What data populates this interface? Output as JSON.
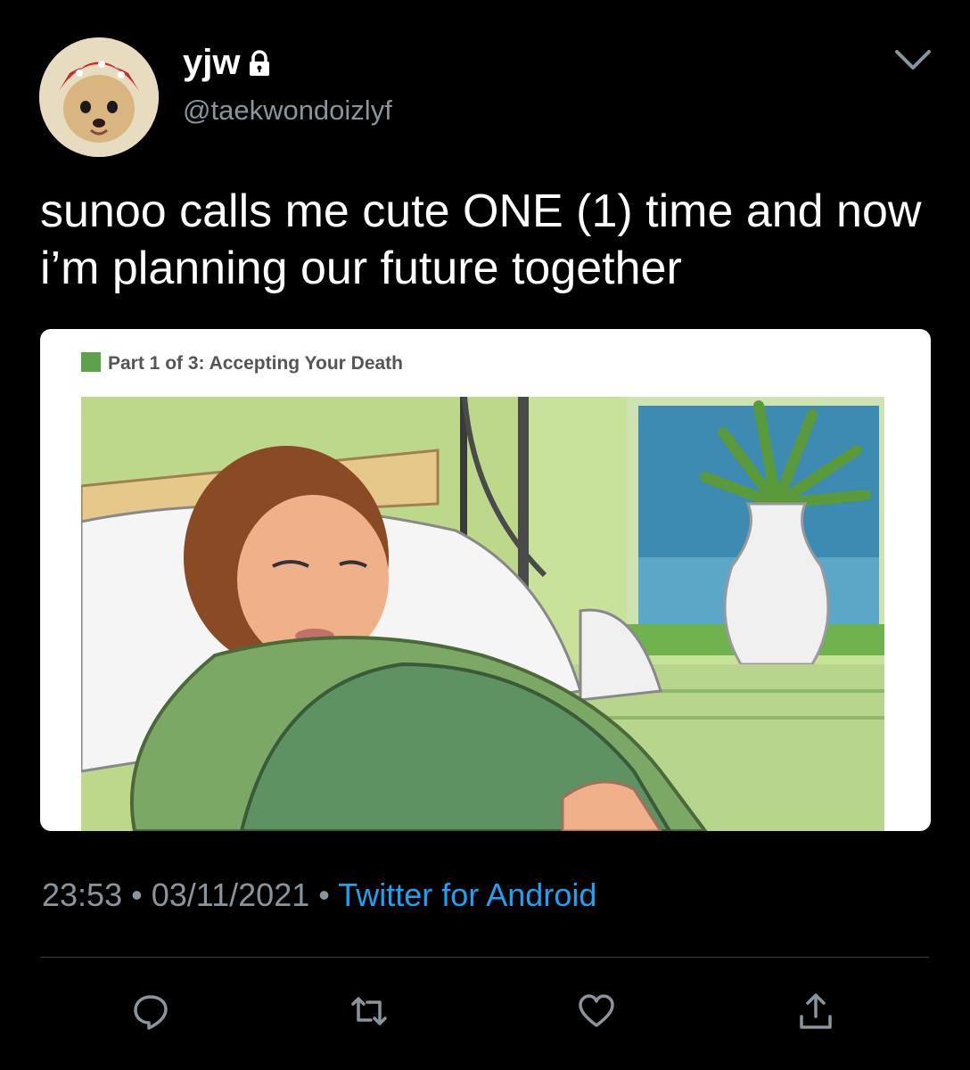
{
  "author": {
    "name": "yjw",
    "handle": "@taekwondoizlyf",
    "protected": true
  },
  "tweet": {
    "text": "sunoo calls me cute ONE (1) time and now i’m planning our future together"
  },
  "media": {
    "caption": "Part 1 of 3: Accepting Your Death"
  },
  "meta": {
    "time": "23:53",
    "separator": "•",
    "date": "03/11/2021",
    "source": "Twitter for Android"
  },
  "actions": [
    "reply-icon",
    "retweet-icon",
    "like-icon",
    "share-icon"
  ],
  "colors": {
    "background": "#000000",
    "secondary_text": "#8a949c",
    "link": "#1da1f2",
    "divider": "#38444d"
  }
}
